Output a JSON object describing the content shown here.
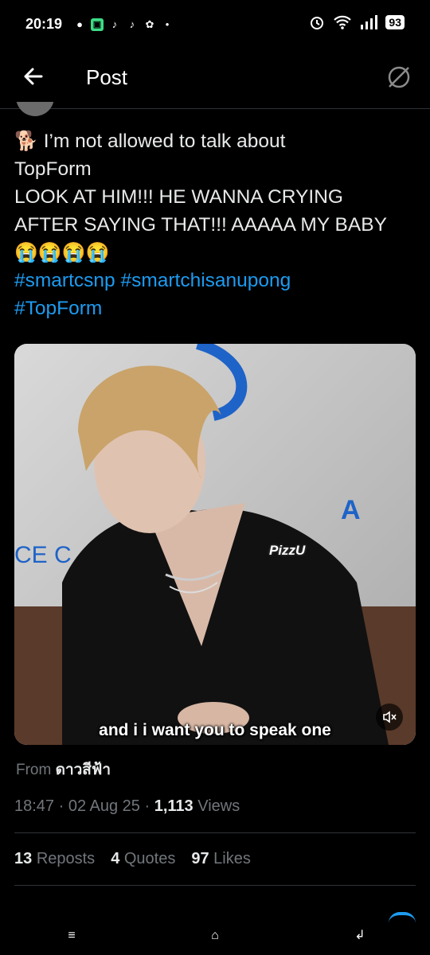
{
  "status_bar": {
    "time": "20:19",
    "battery": "93"
  },
  "header": {
    "title": "Post"
  },
  "tweet": {
    "line1_text": "I’m not allowed to talk about",
    "line2_text": "TopForm",
    "line3_text": "LOOK AT HIM!!! HE WANNA CRYING",
    "line4_text": "AFTER SAYING THAT!!! AAAAA MY BABY",
    "emojis": "😭😭😭😭",
    "lead_emoji": "🐕",
    "hashtags_line1": [
      "#smartcsnp",
      "#smartchisanupong"
    ],
    "hashtags_line2": [
      "#TopForm"
    ]
  },
  "media": {
    "subtitle": "and i i want you to speak one",
    "watermark": "PizzU"
  },
  "source": {
    "label": "From",
    "name": "ดาวสีฟ้า"
  },
  "meta": {
    "time": "18:47",
    "date": "02 Aug 25",
    "views_count": "1,113",
    "views_label": "Views"
  },
  "stats": {
    "reposts_count": "13",
    "reposts_label": "Reposts",
    "quotes_count": "4",
    "quotes_label": "Quotes",
    "likes_count": "97",
    "likes_label": "Likes"
  },
  "colors": {
    "link": "#1d9bf0",
    "muted": "#71767b",
    "text": "#e7e9ea",
    "background": "#000000"
  }
}
